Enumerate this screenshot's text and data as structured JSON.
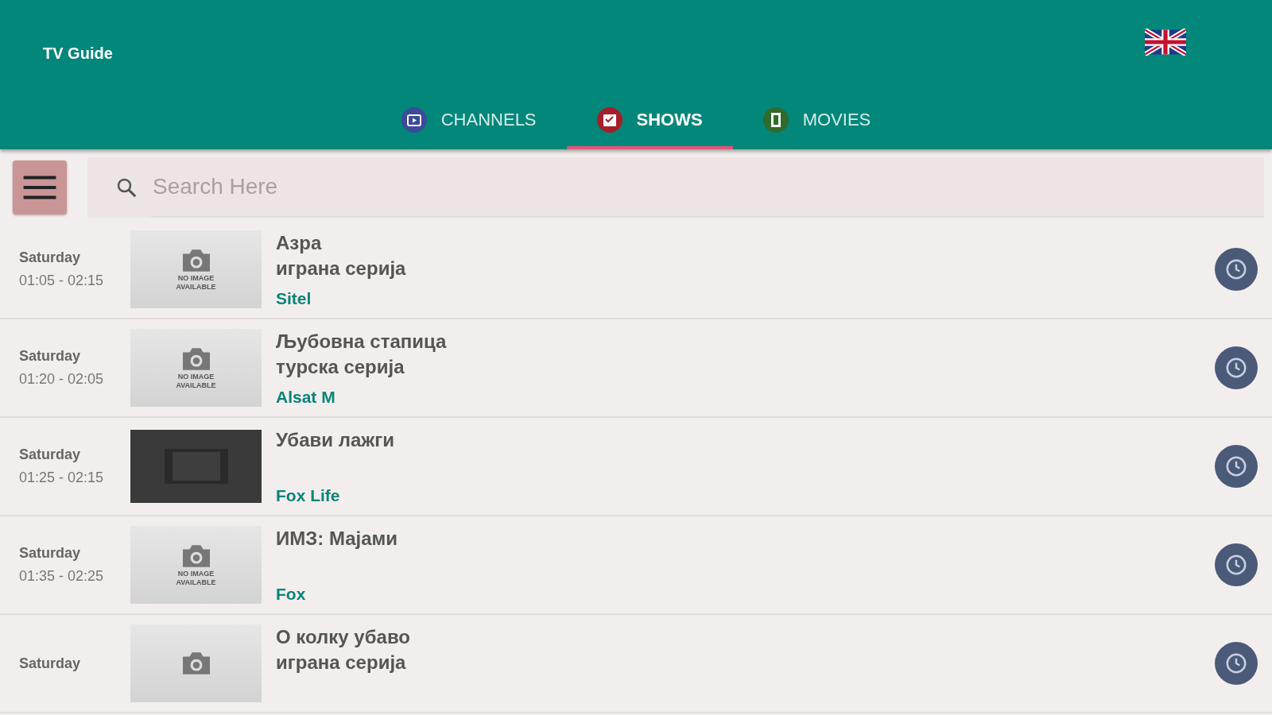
{
  "app_bar": {
    "title": "TV Guide"
  },
  "tabs": [
    {
      "label": "CHANNELS",
      "selected": false,
      "color": "#3c4a9a",
      "kind": "tv"
    },
    {
      "label": "SHOWS",
      "selected": true,
      "color": "#a51f2a",
      "kind": "clapper"
    },
    {
      "label": "MOVIES",
      "selected": false,
      "color": "#2f6b2a",
      "kind": "film"
    }
  ],
  "search": {
    "placeholder": "Search Here"
  },
  "shows": [
    {
      "day": "Saturday",
      "time": "01:05 - 02:15",
      "kind": "no-image",
      "caption": [
        "NO IMAGE",
        "AVAILABLE"
      ],
      "title": [
        "Азра",
        "играна серија"
      ],
      "channel": "Sitel"
    },
    {
      "day": "Saturday",
      "time": "01:20 - 02:05",
      "kind": "no-image",
      "caption": [
        "NO IMAGE",
        "AVAILABLE"
      ],
      "title": [
        "Љубовна стапица",
        "турска серија"
      ],
      "channel": "Alsat M"
    },
    {
      "day": "Saturday",
      "time": "01:25 - 02:15",
      "kind": "film",
      "title": [
        "Убави лажги"
      ],
      "channel": "Fox Life"
    },
    {
      "day": "Saturday",
      "time": "01:35 - 02:25",
      "kind": "no-image",
      "caption": [
        "NO IMAGE",
        "AVAILABLE"
      ],
      "title": [
        "ИМЗ: Мајами"
      ],
      "channel": "Fox"
    },
    {
      "day": "Saturday",
      "kind": "no-image",
      "title": [
        "О колку убаво",
        "играна серија"
      ]
    }
  ]
}
